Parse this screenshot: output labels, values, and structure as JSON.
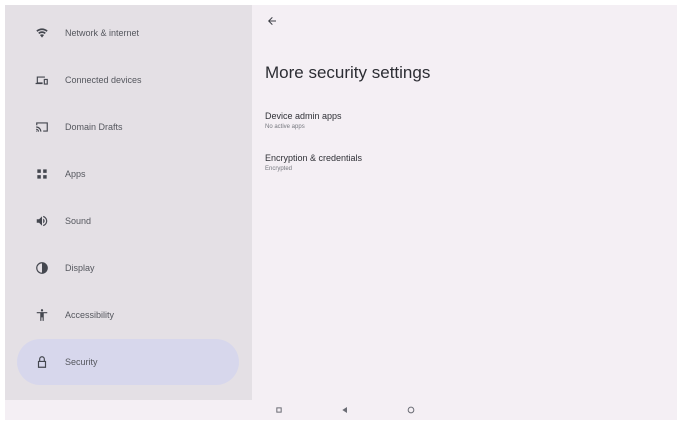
{
  "sidebar": {
    "items": [
      {
        "label": "Network & internet",
        "icon": "wifi-icon"
      },
      {
        "label": "Connected devices",
        "icon": "devices-icon"
      },
      {
        "label": "Domain Drafts",
        "icon": "cast-icon"
      },
      {
        "label": "Apps",
        "icon": "apps-icon"
      },
      {
        "label": "Sound",
        "icon": "volume-icon"
      },
      {
        "label": "Display",
        "icon": "brightness-icon"
      },
      {
        "label": "Accessibility",
        "icon": "accessibility-icon"
      },
      {
        "label": "Security",
        "icon": "lock-icon",
        "active": true
      }
    ]
  },
  "main": {
    "title": "More security settings",
    "prefs": [
      {
        "title": "Device admin apps",
        "summary": "No active apps"
      },
      {
        "title": "Encryption & credentials",
        "summary": "Encrypted"
      }
    ]
  },
  "navbar": {
    "buttons": [
      "recents-icon",
      "back-icon",
      "home-icon"
    ]
  },
  "colors": {
    "sidebar_bg": "#e4e0e5",
    "main_bg": "#f4eff4",
    "active_item": "#d7d7ec"
  }
}
